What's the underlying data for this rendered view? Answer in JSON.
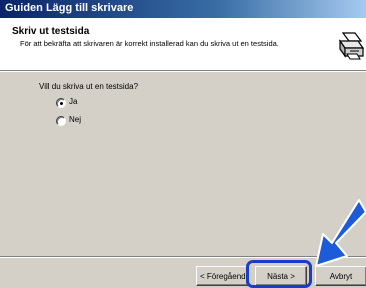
{
  "window": {
    "title": "Guiden Lägg till skrivare"
  },
  "header": {
    "title": "Skriv ut testsida",
    "subtitle": "För att bekräfta att skrivaren är korrekt installerad kan du skriva ut en testsida.",
    "icon": "printer-icon"
  },
  "main": {
    "question": "Vill du skriva ut en testsida?",
    "options": [
      {
        "label": "Ja",
        "selected": true
      },
      {
        "label": "Nej",
        "selected": false
      }
    ]
  },
  "buttons": {
    "back_label": "< Föregående",
    "next_label": "Nästa >",
    "cancel_label": "Avbryt"
  },
  "colors": {
    "highlight": "#1a3cc8",
    "arrow": "#1e5bd8"
  }
}
